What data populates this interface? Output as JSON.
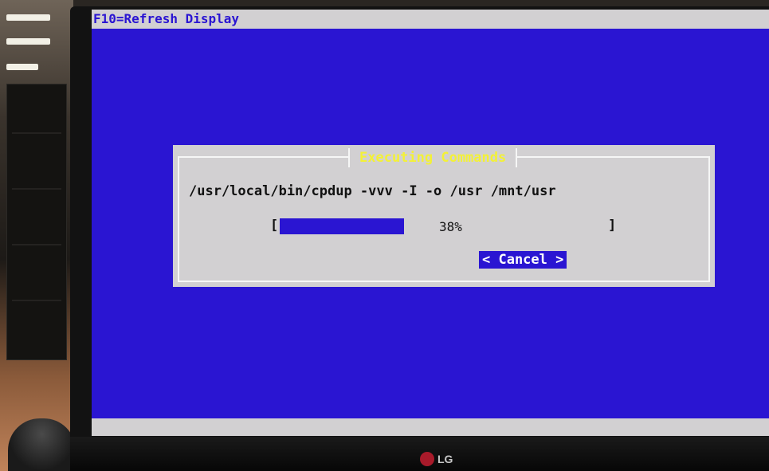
{
  "screen": {
    "top_bar_text": "F10=Refresh Display",
    "background_color": "#2a15d2",
    "bar_color": "#d2d0d2"
  },
  "dialog": {
    "title": "Executing Commands",
    "title_color": "#f3f136",
    "command": "/usr/local/bin/cpdup -vvv -I -o /usr /mnt/usr",
    "progress": {
      "left_bracket": "[",
      "right_bracket": "]",
      "percent": 38,
      "percent_label": "38%"
    },
    "cancel_label": "< Cancel >"
  },
  "monitor": {
    "brand": "LG",
    "brand_color": "#a81a2a"
  }
}
